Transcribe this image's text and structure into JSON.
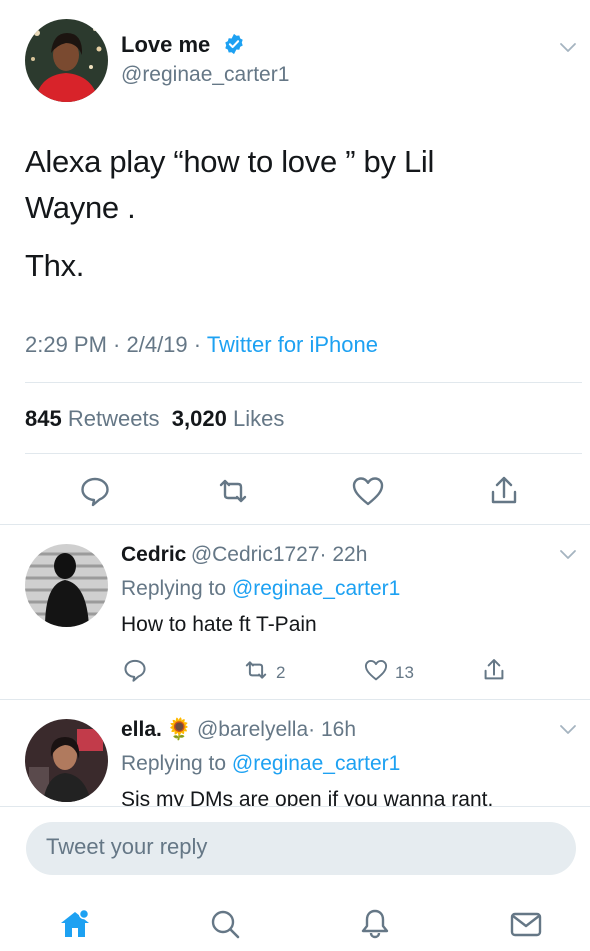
{
  "tweet": {
    "display_name": "Love me",
    "handle": "@reginae_carter1",
    "text_line1": "Alexa play “how to love ” by Lil",
    "text_line2": "Wayne .",
    "text_line3": "Thx.",
    "time": "2:29 PM · 2/4/19 · ",
    "source": "Twitter for iPhone",
    "retweets_count": "845",
    "retweets_label": "Retweets",
    "likes_count": "3,020",
    "likes_label": "Likes",
    "verified": true
  },
  "replies": [
    {
      "name": "Cedric",
      "handle": "@Cedric1727",
      "time": "· 22h",
      "replying_prefix": "Replying to ",
      "replying_to": "@reginae_carter1",
      "text": "How to hate ft T-Pain",
      "retweets": "2",
      "likes": "13"
    },
    {
      "name": "ella.",
      "emoji": "🌻",
      "handle": "@barelyella",
      "time": "· 16h",
      "replying_prefix": "Replying to ",
      "replying_to": "@reginae_carter1",
      "text": "Sis my DMs are open if you wanna rant."
    }
  ],
  "compose": {
    "placeholder": "Tweet your reply"
  },
  "tabs": [
    "home-icon",
    "search-icon",
    "notifications-icon",
    "messages-icon"
  ],
  "colors": {
    "accent": "#1da1f2",
    "secondary_text": "#657786",
    "divider": "#e1e8ed"
  }
}
